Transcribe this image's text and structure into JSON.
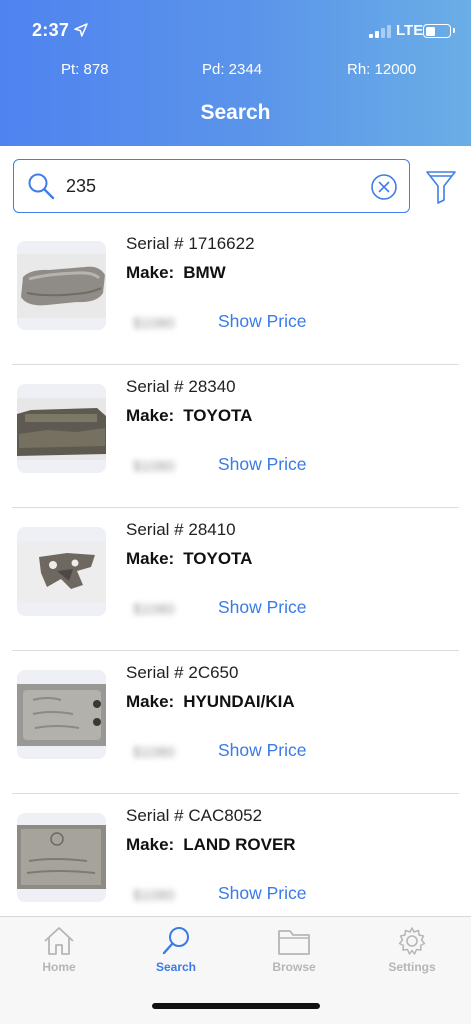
{
  "status_bar": {
    "time": "2:37",
    "network": "LTE",
    "location_icon": "location-arrow-icon",
    "signal_icon": "signal-bars-icon",
    "battery_icon": "battery-icon"
  },
  "stats": {
    "pt": "Pt: 878",
    "pd": "Pd: 2344",
    "rh": "Rh: 12000"
  },
  "header": {
    "title": "Search",
    "gradient_start": "#4f83f0",
    "gradient_end": "#6aaee6"
  },
  "search": {
    "value": "235",
    "search_icon": "search-icon",
    "clear_icon": "clear-circle-x-icon",
    "filter_icon": "filter-funnel-icon"
  },
  "results": [
    {
      "serial": "Serial # 1716622",
      "make_label": "Make:",
      "make": "BMW",
      "price_blurred": "$1080",
      "show_price": "Show Price"
    },
    {
      "serial": "Serial # 28340",
      "make_label": "Make:",
      "make": "TOYOTA",
      "price_blurred": "$1080",
      "show_price": "Show Price"
    },
    {
      "serial": "Serial # 28410",
      "make_label": "Make:",
      "make": "TOYOTA",
      "price_blurred": "$1080",
      "show_price": "Show Price"
    },
    {
      "serial": "Serial # 2C650",
      "make_label": "Make:",
      "make": "HYUNDAI/KIA",
      "price_blurred": "$1080",
      "show_price": "Show Price"
    },
    {
      "serial": "Serial # CAC8052",
      "make_label": "Make:",
      "make": "LAND ROVER",
      "price_blurred": "$1080",
      "show_price": "Show Price"
    }
  ],
  "tab_bar": {
    "tabs": [
      {
        "label": "Home",
        "icon": "home-icon",
        "active": false
      },
      {
        "label": "Search",
        "icon": "search-icon",
        "active": true
      },
      {
        "label": "Browse",
        "icon": "folder-icon",
        "active": false
      },
      {
        "label": "Settings",
        "icon": "gear-icon",
        "active": false
      }
    ],
    "active_color": "#3a7be6",
    "inactive_color": "#b6b6b6"
  },
  "colors": {
    "accent": "#3a7be6",
    "search_border": "#3f7ee8"
  }
}
